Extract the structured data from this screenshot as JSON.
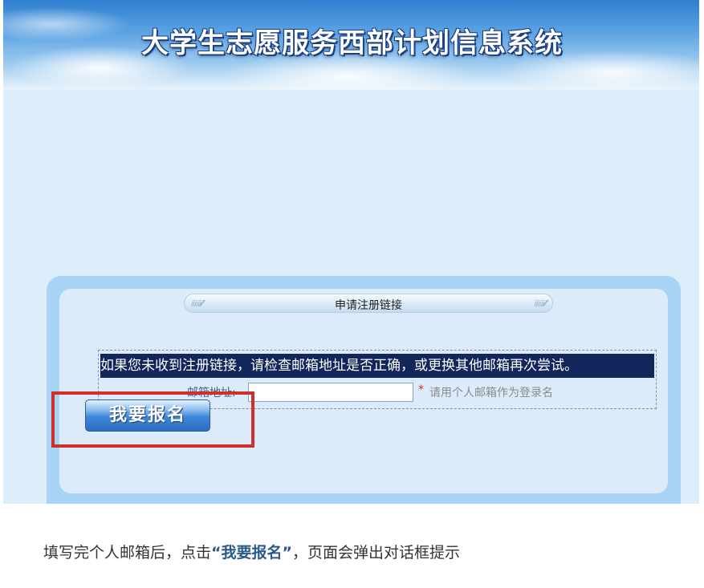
{
  "banner": {
    "title": "大学生志愿服务西部计划信息系统"
  },
  "panel": {
    "tab_title": "申请注册链接",
    "tab_deco_left": "ⅱⅱⅱ⁄⁄⁄",
    "tab_deco_right": "ⅱⅱⅱ⁄⁄⁄"
  },
  "form": {
    "notice": "如果您未收到注册链接，请检查邮箱地址是否正确，或更换其他邮箱再次尝试。",
    "email_label": "邮箱地址:",
    "email_value": "",
    "required_mark": "*",
    "email_hint": "请用个人邮箱作为登录名",
    "signup_button": "我要报名"
  },
  "caption": {
    "before": "填写完个人邮箱后，点击",
    "emphasis": "“我要报名”",
    "after": "，页面会弹出对话框提示"
  },
  "colors": {
    "banner_sky": "#5aa2e2",
    "page_bg": "#ddeefb",
    "notice_bg": "#12265c",
    "highlight": "#d0302a",
    "button": "#2b6fc4"
  }
}
